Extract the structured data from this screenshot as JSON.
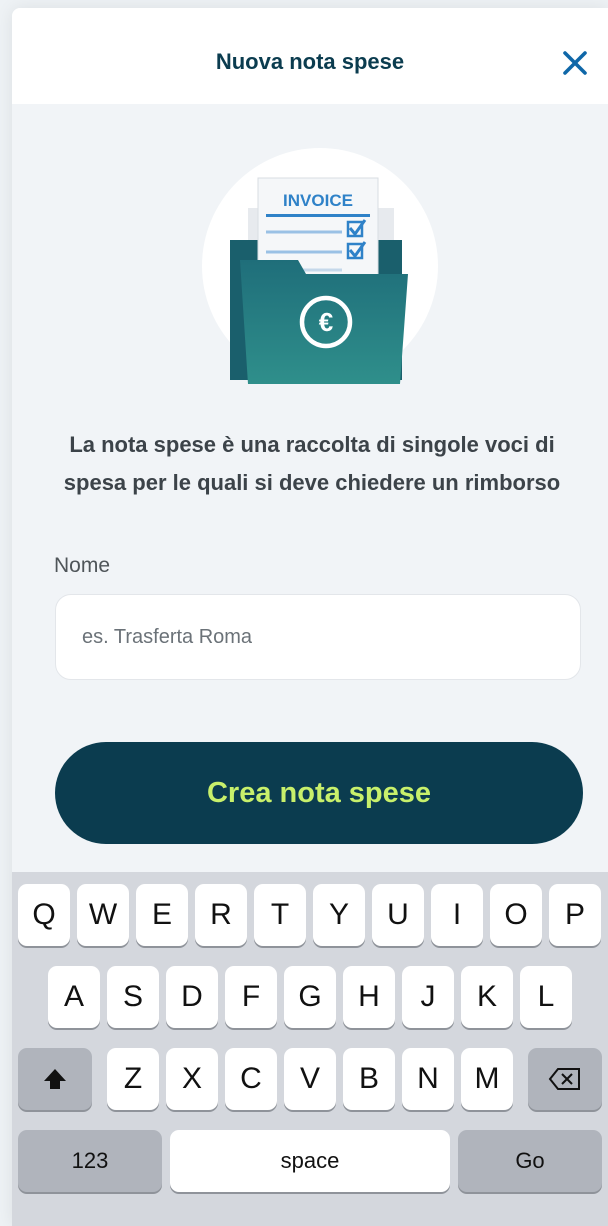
{
  "header": {
    "title": "Nuova nota spese",
    "close_icon": "close-icon"
  },
  "illustration": {
    "doc_title": "INVOICE",
    "currency_symbol": "€"
  },
  "description": "La nota spese è una raccolta di singole voci di spesa per le quali si deve chiedere un rimborso",
  "form": {
    "name_label": "Nome",
    "name_placeholder": "es. Trasferta Roma",
    "name_value": ""
  },
  "cta": {
    "label": "Crea nota spese"
  },
  "keyboard": {
    "row1": [
      "Q",
      "W",
      "E",
      "R",
      "T",
      "Y",
      "U",
      "I",
      "O",
      "P"
    ],
    "row2": [
      "A",
      "S",
      "D",
      "F",
      "G",
      "H",
      "J",
      "K",
      "L"
    ],
    "row3": [
      "Z",
      "X",
      "C",
      "V",
      "B",
      "N",
      "M"
    ],
    "numbers_label": "123",
    "space_label": "space",
    "go_label": "Go"
  },
  "colors": {
    "primary": "#0b3c4f",
    "accent": "#c8f06b",
    "folder_teal_top": "#1f6e7a",
    "folder_teal_bottom": "#2f8f8b",
    "checkbox_blue": "#2f82c8"
  }
}
